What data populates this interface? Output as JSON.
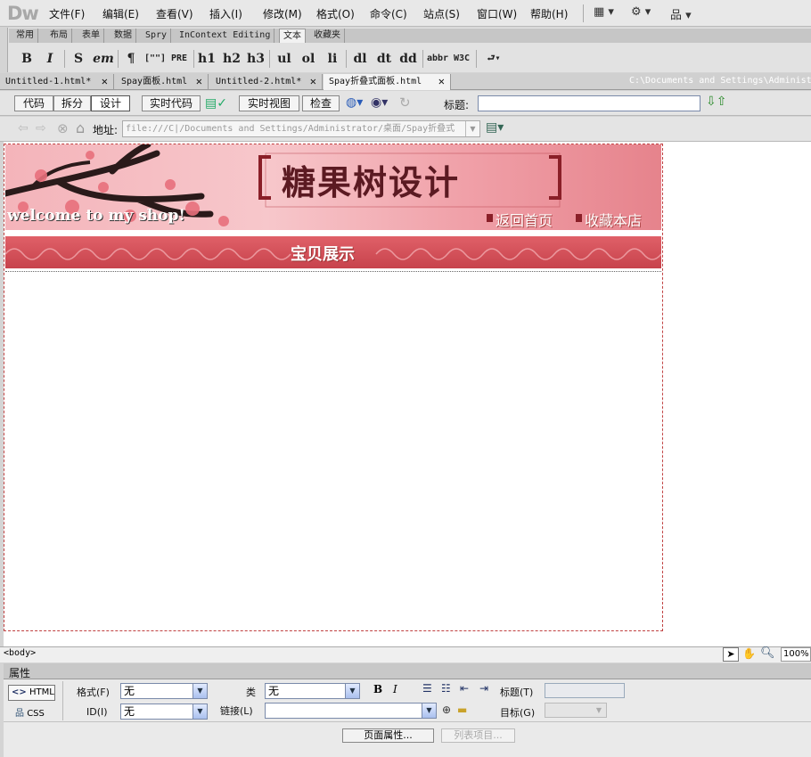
{
  "app": {
    "logo": "Dw"
  },
  "menu": [
    "文件(F)",
    "编辑(E)",
    "查看(V)",
    "插入(I)",
    "修改(M)",
    "格式(O)",
    "命令(C)",
    "站点(S)",
    "窗口(W)",
    "帮助(H)"
  ],
  "insert_tabs": [
    "常用",
    "布局",
    "表单",
    "数据",
    "Spry",
    "InContext Editing",
    "文本",
    "收藏夹"
  ],
  "text_tools": [
    "B",
    "I",
    "S",
    "em",
    "¶",
    "[\"\"]",
    "PRE",
    "h1",
    "h2",
    "h3",
    "ul",
    "ol",
    "li",
    "dl",
    "dt",
    "dd",
    "abbr",
    "W3C"
  ],
  "doc_tabs": [
    "Untitled-1.html*",
    "Spay面板.html",
    "Untitled-2.html*",
    "Spay折叠式面板.html"
  ],
  "doc_path": "C:\\Documents and Settings\\Administ",
  "view_buttons": {
    "code": "代码",
    "split": "拆分",
    "design": "设计",
    "live_code": "实时代码",
    "live_view": "实时视图",
    "inspect": "检查",
    "title_label": "标题:"
  },
  "address": {
    "label": "地址:",
    "value": "file:///C|/Documents and Settings/Administrator/桌面/Spay折叠式"
  },
  "page": {
    "banner_title": "糖果树设计",
    "welcome": "welcome to my shop!",
    "home_link": "返回首页",
    "fav_link": "收藏本店",
    "section_title": "宝贝展示"
  },
  "status": {
    "tag": "<body>",
    "zoom": "100%"
  },
  "properties": {
    "panel_title": "属性",
    "html_btn": "HTML",
    "css_btn": "CSS",
    "format_label": "格式(F)",
    "format_value": "无",
    "class_label": "类",
    "class_value": "无",
    "id_label": "ID(I)",
    "id_value": "无",
    "link_label": "链接(L)",
    "link_value": "",
    "heading_label": "标题(T)",
    "target_label": "目标(G)",
    "page_props_btn": "页面属性...",
    "list_item_btn": "列表项目..."
  }
}
